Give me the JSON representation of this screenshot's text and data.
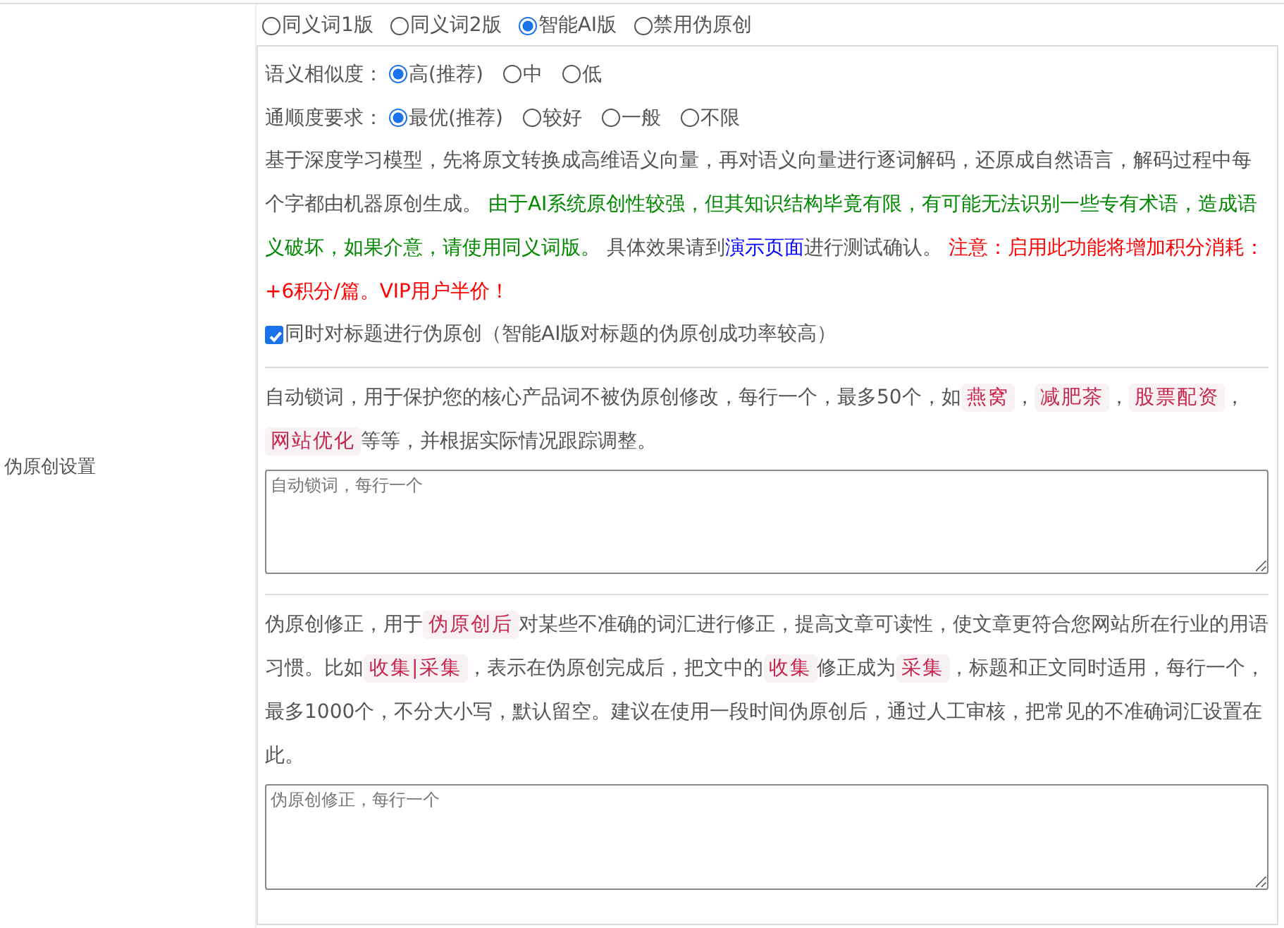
{
  "row_label": "伪原创设置",
  "modes": [
    {
      "label": "同义词1版",
      "selected": false
    },
    {
      "label": "同义词2版",
      "selected": false
    },
    {
      "label": "智能AI版",
      "selected": true
    },
    {
      "label": "禁用伪原创",
      "selected": false
    }
  ],
  "settings": [
    {
      "label": "语义相似度：",
      "options": [
        {
          "label": "高(推荐)",
          "selected": true
        },
        {
          "label": "中",
          "selected": false
        },
        {
          "label": "低",
          "selected": false
        }
      ]
    },
    {
      "label": "通顺度要求：",
      "options": [
        {
          "label": "最优(推荐)",
          "selected": true
        },
        {
          "label": "较好",
          "selected": false
        },
        {
          "label": "一般",
          "selected": false
        },
        {
          "label": "不限",
          "selected": false
        }
      ]
    }
  ],
  "description": [
    {
      "kind": "text",
      "text": "基于深度学习模型，先将原文转换成高维语义向量，再对语义向量进行逐词解码，还原成自然语言，解码过程中每个字都由机器原创生成。 "
    },
    {
      "kind": "green",
      "text": "由于AI系统原创性较强，但其知识结构毕竟有限，有可能无法识别一些专有术语，造成语义破坏，如果介意，请使用同义词版。"
    },
    {
      "kind": "text",
      "text": " 具体效果请到"
    },
    {
      "kind": "link",
      "text": "演示页面"
    },
    {
      "kind": "text",
      "text": "进行测试确认。 "
    },
    {
      "kind": "red",
      "text": "注意：启用此功能将增加积分消耗：+6积分/篇。VIP用户半价！"
    }
  ],
  "title_option": {
    "label": "同时对标题进行伪原创（智能AI版对标题的伪原创成功率较高）",
    "checked": true
  },
  "lock_words": {
    "description": [
      {
        "kind": "text",
        "text": "自动锁词，用于保护您的核心产品词不被伪原创修改，每行一个，最多50个，如"
      },
      {
        "kind": "code",
        "text": "燕窝"
      },
      {
        "kind": "text",
        "text": "，"
      },
      {
        "kind": "code",
        "text": "减肥茶"
      },
      {
        "kind": "text",
        "text": "，"
      },
      {
        "kind": "code",
        "text": "股票配资"
      },
      {
        "kind": "text",
        "text": "，"
      },
      {
        "kind": "code",
        "text": "网站优化"
      },
      {
        "kind": "text",
        "text": "等等，并根据实际情况跟踪调整。"
      }
    ],
    "placeholder": "自动锁词，每行一个"
  },
  "corrections": {
    "description": [
      {
        "kind": "text",
        "text": "伪原创修正，用于"
      },
      {
        "kind": "code",
        "text": "伪原创后"
      },
      {
        "kind": "text",
        "text": "对某些不准确的词汇进行修正，提高文章可读性，使文章更符合您网站所在行业的用语习惯。比如"
      },
      {
        "kind": "code",
        "text": "收集|采集"
      },
      {
        "kind": "text",
        "text": "，表示在伪原创完成后，把文中的"
      },
      {
        "kind": "code",
        "text": "收集"
      },
      {
        "kind": "text",
        "text": "修正成为"
      },
      {
        "kind": "code",
        "text": "采集"
      },
      {
        "kind": "text",
        "text": "，标题和正文同时适用，每行一个，最多1000个，不分大小写，默认留空。建议在使用一段时间伪原创后，通过人工审核，把常见的不准确词汇设置在此。"
      }
    ],
    "placeholder": "伪原创修正，每行一个"
  }
}
